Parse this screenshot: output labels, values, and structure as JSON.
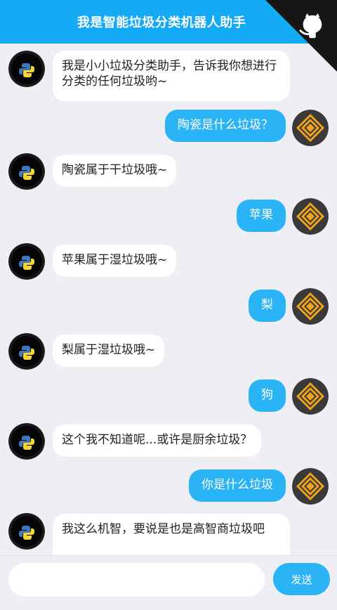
{
  "header": {
    "title": "我是智能垃圾分类机器人助手"
  },
  "messages": [
    {
      "from": "bot",
      "text": "我是小小垃圾分类助手，告诉我你想进行分类的任何垃圾哟~"
    },
    {
      "from": "user",
      "text": "陶瓷是什么垃圾？"
    },
    {
      "from": "bot",
      "text": "陶瓷属于干垃圾哦~"
    },
    {
      "from": "user",
      "text": "苹果"
    },
    {
      "from": "bot",
      "text": "苹果属于湿垃圾哦~"
    },
    {
      "from": "user",
      "text": "梨"
    },
    {
      "from": "bot",
      "text": "梨属于湿垃圾哦~"
    },
    {
      "from": "user",
      "text": "狗"
    },
    {
      "from": "bot",
      "text": "这个我不知道呢...或许是厨余垃圾？"
    },
    {
      "from": "user",
      "text": "你是什么垃圾"
    },
    {
      "from": "bot",
      "text": "我这么机智，要说是也是高智商垃圾吧"
    }
  ],
  "footer": {
    "input_value": "",
    "send_label": "发送"
  },
  "icons": {
    "bot_avatar": "python-logo-icon",
    "user_avatar": "orange-diamond-logo-icon",
    "corner": "github-octocat-icon"
  },
  "colors": {
    "header": "#14aaf5",
    "user_bubble": "#2bb4f5",
    "bot_bubble": "#ffffff",
    "background": "#eeeff5"
  }
}
